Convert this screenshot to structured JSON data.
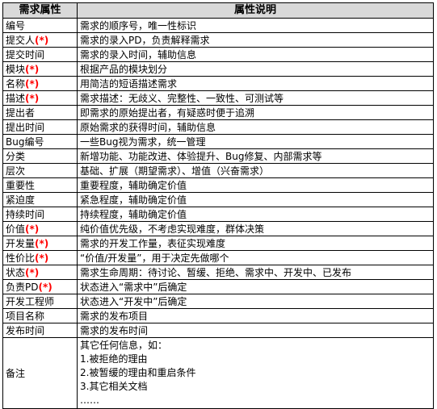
{
  "header": {
    "col1": "需求属性",
    "col2": "属性说明"
  },
  "required_marker": "(*)",
  "rows": [
    {
      "name": "编号",
      "required": false,
      "desc": "需求的顺序号，唯一性标识"
    },
    {
      "name": "提交人",
      "required": true,
      "desc": "需求的录入PD，负责解释需求"
    },
    {
      "name": "提交时间",
      "required": false,
      "desc": "需求的录入时间，辅助信息"
    },
    {
      "name": "模块",
      "required": true,
      "desc": "根据产品的模块划分"
    },
    {
      "name": "名称",
      "required": true,
      "desc": "用简洁的短语描述需求"
    },
    {
      "name": "描述",
      "required": true,
      "desc": "需求描述：无歧义、完整性、一致性、可测试等"
    },
    {
      "name": "提出者",
      "required": false,
      "desc": "即需求的原始提出者，有疑惑时便于追溯"
    },
    {
      "name": "提出时间",
      "required": false,
      "desc": "原始需求的获得时间，辅助信息"
    },
    {
      "name": "Bug编号",
      "required": false,
      "desc": "一些Bug视为需求，统一管理"
    },
    {
      "name": "分类",
      "required": false,
      "desc": "新增功能、功能改进、体验提升、Bug修复、内部需求等"
    },
    {
      "name": "层次",
      "required": false,
      "desc": "基础、扩展（期望需求）、增值（兴奋需求）"
    },
    {
      "name": "重要性",
      "required": false,
      "desc": "重要程度，辅助确定价值"
    },
    {
      "name": "紧迫度",
      "required": false,
      "desc": "紧急程度，辅助确定价值"
    },
    {
      "name": "持续时间",
      "required": false,
      "desc": "持续程度，辅助确定价值"
    },
    {
      "name": "价值",
      "required": true,
      "desc": "纯价值优先级，不考虑实现难度，群体决策"
    },
    {
      "name": "开发量",
      "required": true,
      "desc": "需求的开发工作量，表征实现难度"
    },
    {
      "name": "性价比",
      "required": true,
      "desc": "“价值/开发量”，用于决定先做哪个"
    },
    {
      "name": "状态",
      "required": true,
      "desc": "需求生命周期：待讨论、暂缓、拒绝、需求中、开发中、已发布"
    },
    {
      "name": "负责PD",
      "required": true,
      "desc": "状态进入“需求中”后确定"
    },
    {
      "name": "开发工程师",
      "required": false,
      "desc": "状态进入“开发中”后确定"
    },
    {
      "name": "项目名称",
      "required": false,
      "desc": "需求的发布项目"
    },
    {
      "name": "发布时间",
      "required": false,
      "desc": "需求的发布时间"
    }
  ],
  "notes_row": {
    "name": "备注",
    "lines": [
      "其它任何信息，如：",
      "1.被拒绝的理由",
      "2.被暂缓的理由和重启条件",
      "3.其它相关文档",
      "……"
    ]
  }
}
